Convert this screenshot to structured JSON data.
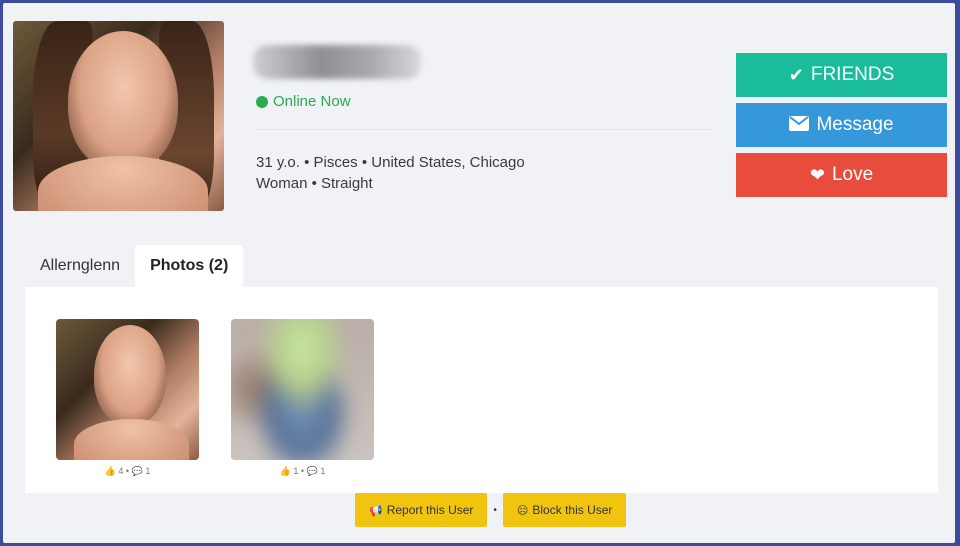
{
  "profile": {
    "status": "Online Now",
    "info_line1": "31 y.o. • Pisces • United States, Chicago",
    "info_line2": "Woman • Straight"
  },
  "actions": {
    "friends_label": "FRIENDS",
    "message_label": "Message",
    "love_label": "Love"
  },
  "tabs": [
    {
      "label": "Allernglenn",
      "active": false
    },
    {
      "label": "Photos (2)",
      "active": true
    }
  ],
  "photos": [
    {
      "likes": "4",
      "comments": "1"
    },
    {
      "likes": "1",
      "comments": "1"
    }
  ],
  "footer": {
    "report_label": "Report this User",
    "separator": "•",
    "block_label": "Block this User"
  },
  "colors": {
    "online": "#2bab52",
    "friends": "#1abc9c",
    "message": "#3498db",
    "love": "#e74c3c",
    "footer_button": "#f1c40f"
  },
  "icons": {
    "online": "status-dot-icon",
    "friends": "check-icon",
    "message": "envelope-icon",
    "love": "heart-icon",
    "likes": "thumbs-up-icon",
    "comments": "comment-icon",
    "report": "megaphone-icon",
    "block": "frown-icon"
  }
}
